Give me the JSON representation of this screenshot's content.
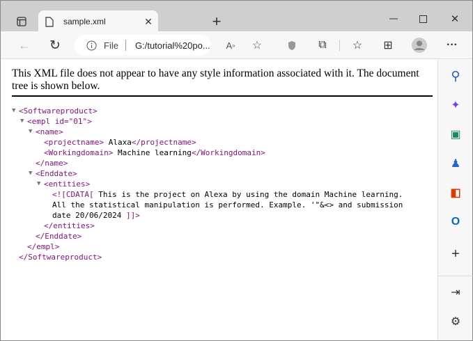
{
  "tab": {
    "title": "sample.xml"
  },
  "address": {
    "scheme": "File",
    "url": "G:/tutorial%20po..."
  },
  "page": {
    "info": "This XML file does not appear to have any style information associated with it. The document tree is shown below.",
    "lines": [
      {
        "open": true,
        "tag": "<Softwareproduct>"
      },
      {
        "open": true,
        "tag": "<empl id=\"01\">"
      },
      {
        "open": true,
        "tag": "<name>"
      },
      {
        "tag": "<projectname>",
        "text": " Alaxa",
        "close": "</projectname>"
      },
      {
        "tag": "<Workingdomain>",
        "text": " Machine learning",
        "close": "</Workingdomain>"
      },
      {
        "tag": "</name>"
      },
      {
        "open": true,
        "tag": "<Enddate>"
      },
      {
        "open": true,
        "tag": "<entities>"
      },
      {
        "tag": "<![CDATA[",
        "text": " This is the project on Alexa by using the domain Machine learning."
      },
      {
        "text": "All the statistical manipulation is performed. Example. '\"&<> and submission"
      },
      {
        "text": "date 20/06/2024 ",
        "close": "]]>"
      },
      {
        "tag": "</entities>"
      },
      {
        "tag": "</Enddate>"
      },
      {
        "tag": "</empl>"
      },
      {
        "tag": "</Softwareproduct>"
      }
    ]
  }
}
